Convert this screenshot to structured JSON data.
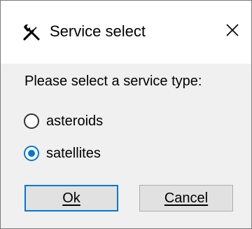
{
  "window": {
    "title": "Service select",
    "title_icon": "tools-icon",
    "close_icon": "close-icon"
  },
  "prompt": "Please select a service type:",
  "options": [
    {
      "label": "asteroids",
      "checked": false
    },
    {
      "label": "satellites",
      "checked": true
    }
  ],
  "buttons": {
    "ok_label": "Ok",
    "cancel_label": "Cancel"
  },
  "colors": {
    "accent": "#0078d7",
    "dialog_bg": "#f0f0f0",
    "titlebar_bg": "#ffffff",
    "button_bg": "#e1e1e1"
  }
}
